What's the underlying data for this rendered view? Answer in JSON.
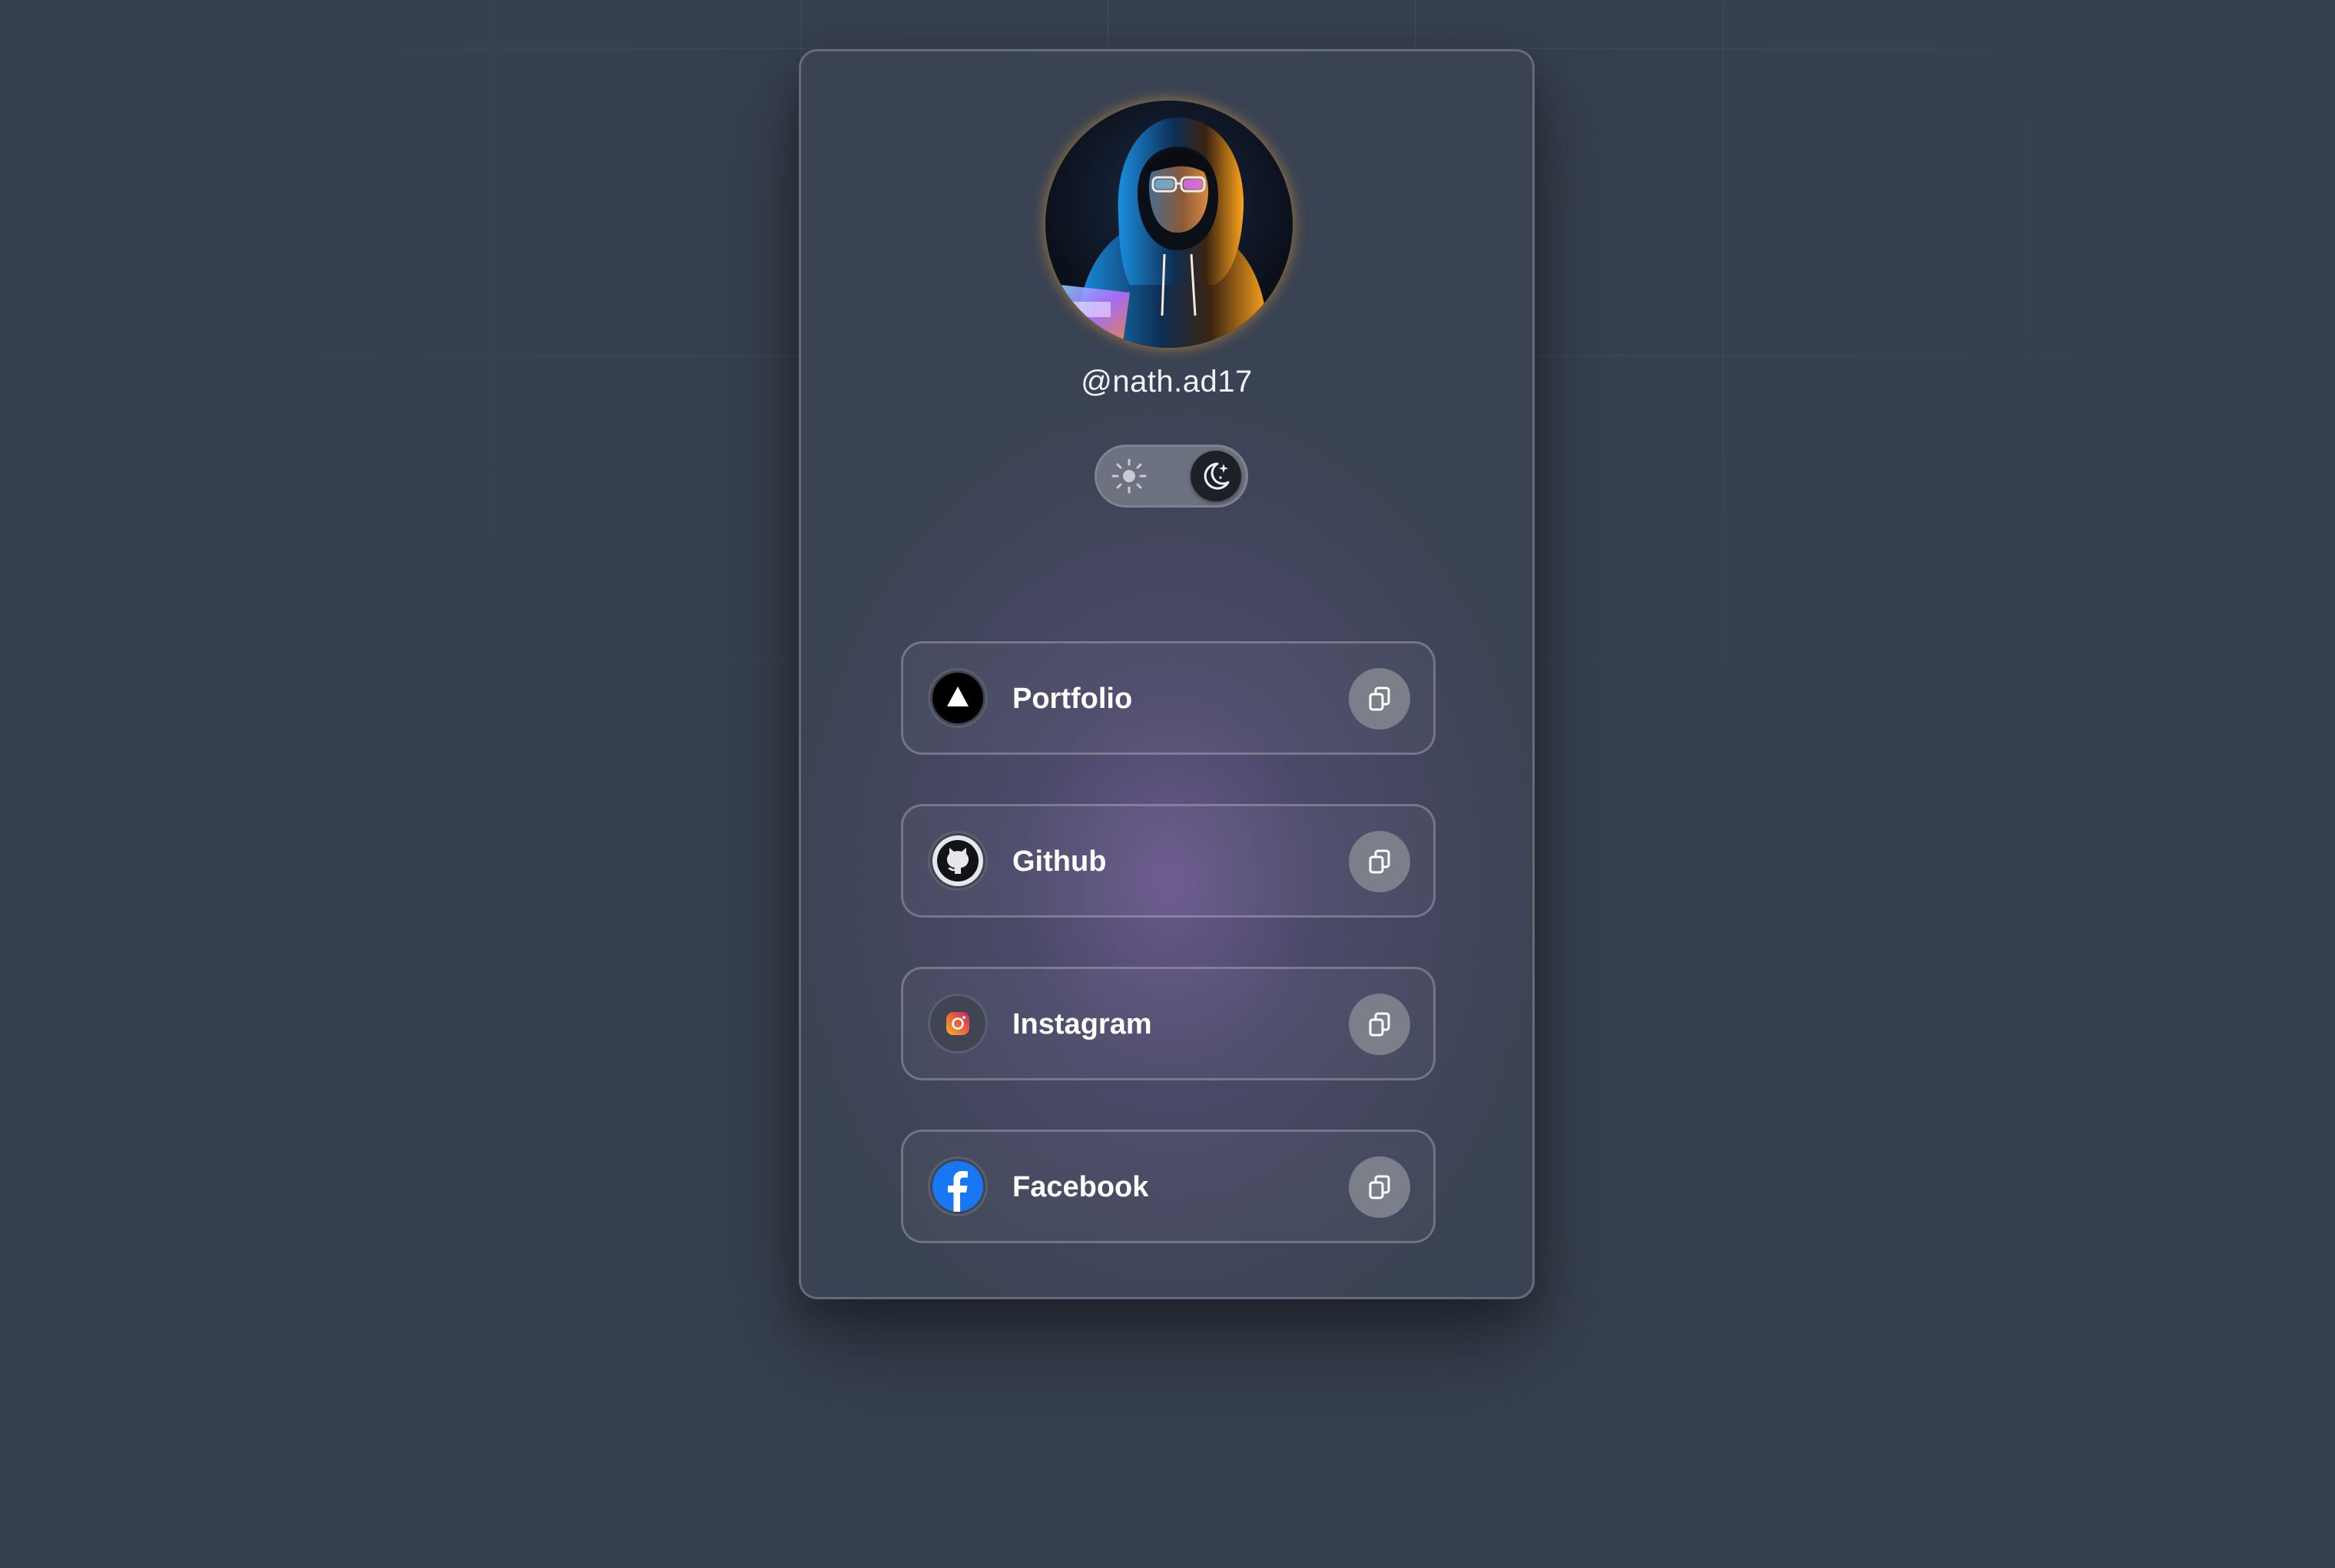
{
  "profile": {
    "username": "@nath.ad17"
  },
  "theme_toggle": {
    "selected": "dark",
    "options": [
      "light-mode",
      "dark-mode"
    ]
  },
  "links": [
    {
      "label": "Portfolio",
      "icon": "triangle-logo-icon",
      "action_icon": "copy-icon"
    },
    {
      "label": "Github",
      "icon": "github-icon",
      "action_icon": "copy-icon"
    },
    {
      "label": "Instagram",
      "icon": "instagram-icon",
      "action_icon": "copy-icon"
    },
    {
      "label": "Facebook",
      "icon": "facebook-icon",
      "action_icon": "copy-icon"
    }
  ],
  "colors": {
    "page_background": "#37404f",
    "card_background": "#3a4353",
    "accent_glow": "#785fa0",
    "facebook_blue": "#1877f2"
  }
}
